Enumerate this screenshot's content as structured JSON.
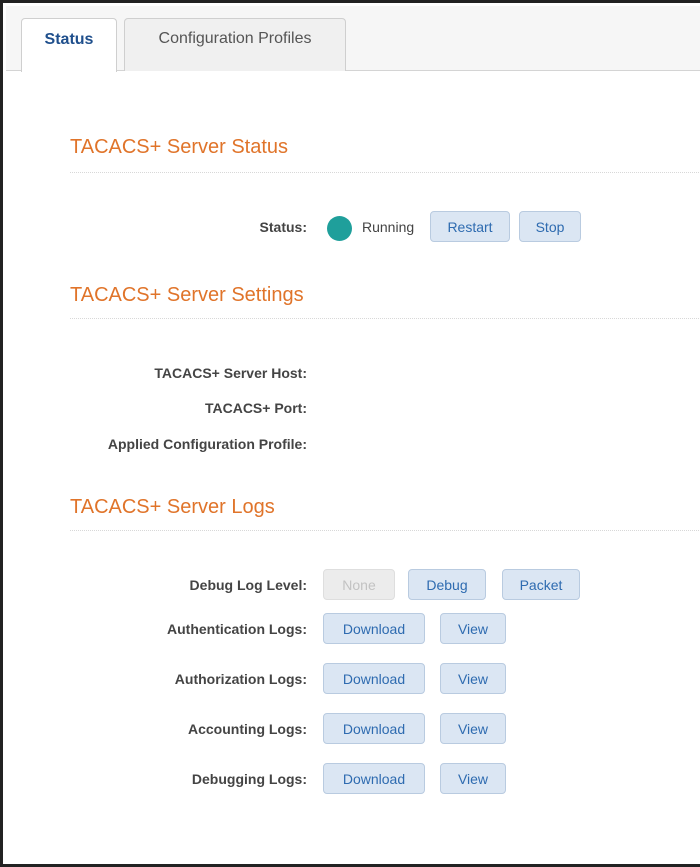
{
  "tabs": [
    {
      "label": "Status"
    },
    {
      "label": "Configuration Profiles"
    }
  ],
  "server_status": {
    "title": "TACACS+ Server Status",
    "status_label": "Status:",
    "status_value": "Running",
    "status_color": "#1f9f9b",
    "restart_label": "Restart",
    "stop_label": "Stop"
  },
  "server_settings": {
    "title": "TACACS+ Server Settings",
    "host_label": "TACACS+ Server Host:",
    "host_value": "",
    "port_label": "TACACS+ Port:",
    "port_value": "",
    "profile_label": "Applied Configuration Profile:",
    "profile_value": ""
  },
  "server_logs": {
    "title": "TACACS+ Server Logs",
    "debug_level_label": "Debug Log Level:",
    "debug_levels": [
      "None",
      "Debug",
      "Packet"
    ],
    "rows": [
      {
        "label": "Authentication Logs:",
        "download": "Download",
        "view": "View"
      },
      {
        "label": "Authorization Logs:",
        "download": "Download",
        "view": "View"
      },
      {
        "label": "Accounting Logs:",
        "download": "Download",
        "view": "View"
      },
      {
        "label": "Debugging Logs:",
        "download": "Download",
        "view": "View"
      }
    ]
  },
  "colors": {
    "accent": "#e0742a",
    "button_bg": "#dbe6f3",
    "button_text": "#2e6bb0",
    "active_tab_text": "#1f4f8c"
  }
}
